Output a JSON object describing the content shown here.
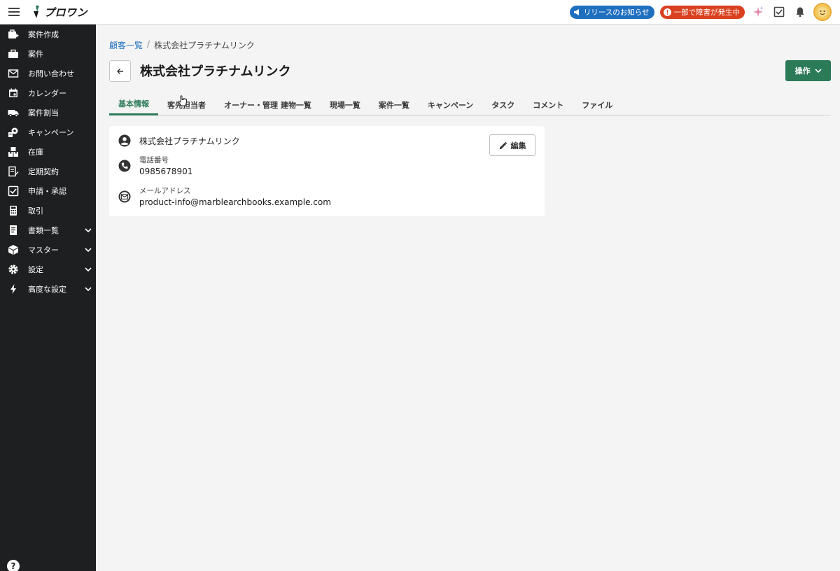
{
  "app": {
    "logo_text": "プロワン"
  },
  "header": {
    "release_label": "リリースのお知らせ",
    "incident_label": "一部で障害が発生中",
    "colors": {
      "release": "#1f6fbf",
      "incident": "#d9401f",
      "accent": "#2b7a58"
    }
  },
  "sidebar": {
    "items": [
      {
        "label": "案件作成",
        "icon": "briefcase-plus-icon",
        "expandable": false
      },
      {
        "label": "案件",
        "icon": "briefcase-icon",
        "expandable": false
      },
      {
        "label": "お問い合わせ",
        "icon": "mail-icon",
        "expandable": false
      },
      {
        "label": "カレンダー",
        "icon": "calendar-icon",
        "expandable": false
      },
      {
        "label": "案件割当",
        "icon": "truck-icon",
        "expandable": false
      },
      {
        "label": "キャンペーン",
        "icon": "campaign-icon",
        "expandable": false
      },
      {
        "label": "在庫",
        "icon": "boxes-icon",
        "expandable": false
      },
      {
        "label": "定期契約",
        "icon": "contract-icon",
        "expandable": false
      },
      {
        "label": "申請・承認",
        "icon": "checkbox-icon",
        "expandable": false
      },
      {
        "label": "取引",
        "icon": "calculator-icon",
        "expandable": false
      },
      {
        "label": "書類一覧",
        "icon": "document-icon",
        "expandable": true
      },
      {
        "label": "マスター",
        "icon": "cube-icon",
        "expandable": true
      },
      {
        "label": "設定",
        "icon": "gear-icon",
        "expandable": true
      },
      {
        "label": "高度な設定",
        "icon": "bolt-icon",
        "expandable": true
      }
    ],
    "help_label": "?"
  },
  "breadcrumb": {
    "parent": "顧客一覧",
    "separator": "/",
    "current": "株式会社プラチナムリンク"
  },
  "page": {
    "title": "株式会社プラチナムリンク",
    "action_label": "操作"
  },
  "tabs": [
    {
      "label": "基本情報",
      "active": true
    },
    {
      "label": "客先担当者",
      "active": false
    },
    {
      "label": "オーナー・管理 建物一覧",
      "active": false
    },
    {
      "label": "現場一覧",
      "active": false
    },
    {
      "label": "案件一覧",
      "active": false
    },
    {
      "label": "キャンペーン",
      "active": false
    },
    {
      "label": "タスク",
      "active": false
    },
    {
      "label": "コメント",
      "active": false
    },
    {
      "label": "ファイル",
      "active": false
    }
  ],
  "card": {
    "company_name": "株式会社プラチナムリンク",
    "phone_label": "電話番号",
    "phone_value": "0985678901",
    "email_label": "メールアドレス",
    "email_value": "product-info@marblearchbooks.example.com",
    "edit_label": "編集"
  }
}
